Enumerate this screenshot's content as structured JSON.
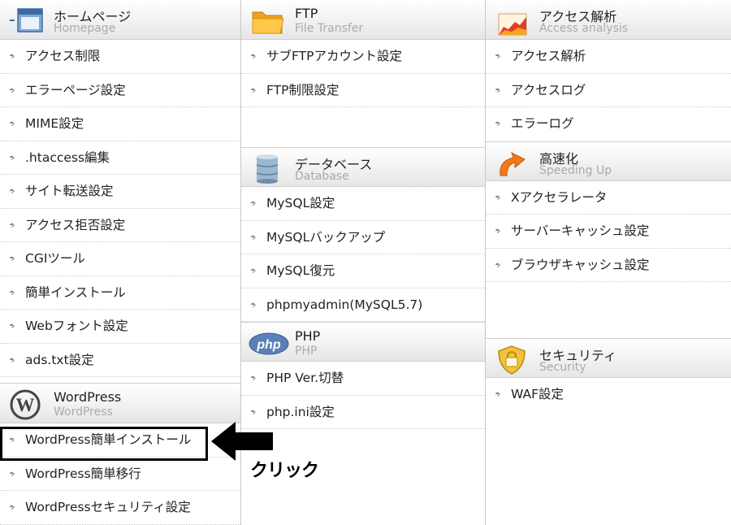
{
  "col1": {
    "homepage": {
      "title": "ホームページ",
      "subtitle": "Homepage",
      "icon": "homepage-window-icon",
      "items": [
        "アクセス制限",
        "エラーページ設定",
        "MIME設定",
        ".htaccess編集",
        "サイト転送設定",
        "アクセス拒否設定",
        "CGIツール",
        "簡単インストール",
        "Webフォント設定",
        "ads.txt設定"
      ]
    },
    "wordpress": {
      "title": "WordPress",
      "subtitle": "WordPress",
      "icon": "wordpress-logo-icon",
      "items": [
        "WordPress簡単インストール",
        "WordPress簡単移行",
        "WordPressセキュリティ設定"
      ]
    }
  },
  "col2": {
    "ftp": {
      "title": "FTP",
      "subtitle": "File Transfer",
      "icon": "folder-icon",
      "items": [
        "サブFTPアカウント設定",
        "FTP制限設定"
      ]
    },
    "database": {
      "title": "データベース",
      "subtitle": "Database",
      "icon": "database-icon",
      "items": [
        "MySQL設定",
        "MySQLバックアップ",
        "MySQL復元",
        "phpmyadmin(MySQL5.7)"
      ]
    },
    "php": {
      "title": "PHP",
      "subtitle": "PHP",
      "icon": "php-logo-icon",
      "items": [
        "PHP Ver.切替",
        "php.ini設定"
      ]
    }
  },
  "col3": {
    "access": {
      "title": "アクセス解析",
      "subtitle": "Access analysis",
      "icon": "chart-icon",
      "items": [
        "アクセス解析",
        "アクセスログ",
        "エラーログ"
      ]
    },
    "speed": {
      "title": "高速化",
      "subtitle": "Speeding Up",
      "icon": "speed-arrow-icon",
      "items": [
        "Xアクセラレータ",
        "サーバーキャッシュ設定",
        "ブラウザキャッシュ設定"
      ]
    },
    "security": {
      "title": "セキュリティ",
      "subtitle": "Security",
      "icon": "shield-lock-icon",
      "items": [
        "WAF設定"
      ]
    }
  },
  "annotation": {
    "click_label": "クリック",
    "arrow_icon": "left-arrow-icon",
    "highlight_color": "#000000"
  }
}
